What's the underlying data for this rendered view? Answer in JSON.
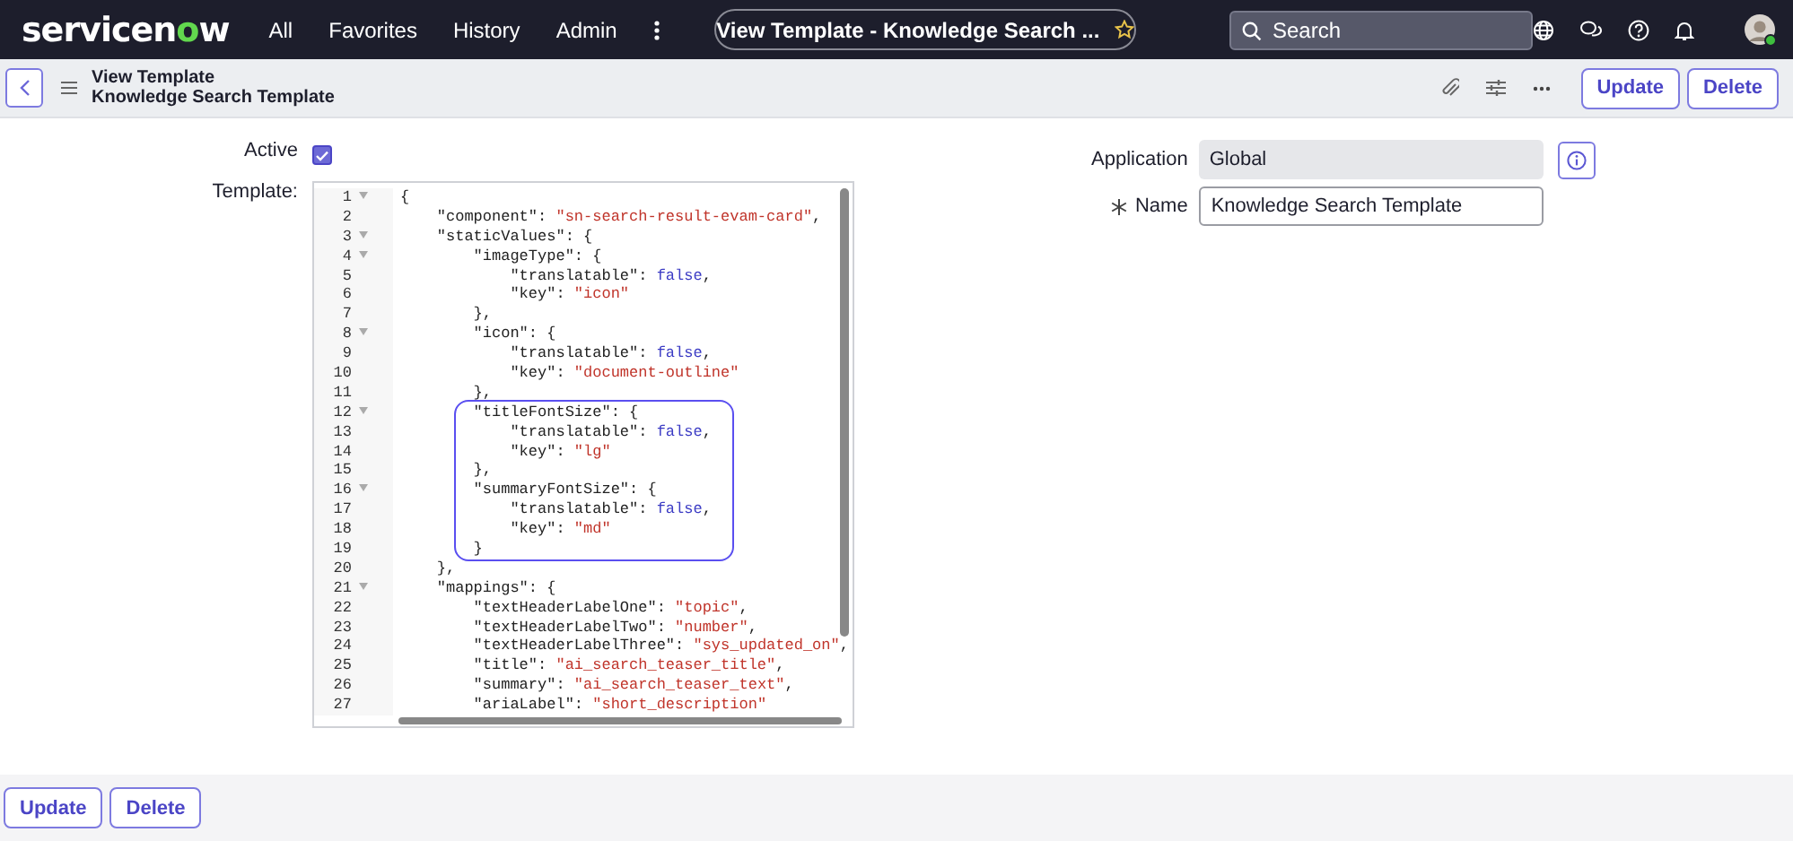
{
  "topbar": {
    "logo": [
      "servicen",
      "o",
      "w"
    ],
    "menu": [
      {
        "label": "All"
      },
      {
        "label": "Favorites"
      },
      {
        "label": "History"
      },
      {
        "label": "Admin"
      }
    ],
    "title_pill": {
      "text": "View Template - Knowledge Search ...",
      "starred": false
    },
    "search": {
      "placeholder": "Search"
    },
    "user": {
      "online": true
    }
  },
  "header": {
    "title": "View Template",
    "subtitle": "Knowledge Search Template",
    "buttons": [
      "Update",
      "Delete"
    ]
  },
  "form": {
    "active": {
      "label": "Active",
      "checked": true
    },
    "template": {
      "label": "Template:",
      "blocks": [
        {
          "highlighted": false,
          "lines": [
            {
              "n": "1",
              "fold": true,
              "tokens": [
                {
                  "kind": "plain",
                  "text": "{"
                }
              ]
            },
            {
              "n": "2",
              "fold": false,
              "tokens": [
                {
                  "kind": "plain",
                  "text": "    \"component\": "
                },
                {
                  "kind": "string",
                  "text": "\"sn-search-result-evam-card\""
                },
                {
                  "kind": "plain",
                  "text": ","
                }
              ]
            },
            {
              "n": "3",
              "fold": true,
              "tokens": [
                {
                  "kind": "plain",
                  "text": "    \"staticValues\": {"
                }
              ]
            },
            {
              "n": "4",
              "fold": true,
              "tokens": [
                {
                  "kind": "plain",
                  "text": "        \"imageType\": {"
                }
              ]
            },
            {
              "n": "5",
              "fold": false,
              "tokens": [
                {
                  "kind": "plain",
                  "text": "            \"translatable\": "
                },
                {
                  "kind": "literal",
                  "text": "false"
                },
                {
                  "kind": "plain",
                  "text": ","
                }
              ]
            },
            {
              "n": "6",
              "fold": false,
              "tokens": [
                {
                  "kind": "plain",
                  "text": "            \"key\": "
                },
                {
                  "kind": "string",
                  "text": "\"icon\""
                }
              ]
            },
            {
              "n": "7",
              "fold": false,
              "tokens": [
                {
                  "kind": "plain",
                  "text": "        },"
                }
              ]
            },
            {
              "n": "8",
              "fold": true,
              "tokens": [
                {
                  "kind": "plain",
                  "text": "        \"icon\": {"
                }
              ]
            },
            {
              "n": "9",
              "fold": false,
              "tokens": [
                {
                  "kind": "plain",
                  "text": "            \"translatable\": "
                },
                {
                  "kind": "literal",
                  "text": "false"
                },
                {
                  "kind": "plain",
                  "text": ","
                }
              ]
            },
            {
              "n": "10",
              "fold": false,
              "tokens": [
                {
                  "kind": "plain",
                  "text": "            \"key\": "
                },
                {
                  "kind": "string",
                  "text": "\"document-outline\""
                }
              ]
            },
            {
              "n": "11",
              "fold": false,
              "tokens": [
                {
                  "kind": "plain",
                  "text": "        },"
                }
              ]
            }
          ]
        },
        {
          "highlighted": true,
          "lines": [
            {
              "n": "12",
              "fold": true,
              "tokens": [
                {
                  "kind": "plain",
                  "text": "        \"titleFontSize\": {"
                }
              ]
            },
            {
              "n": "13",
              "fold": false,
              "tokens": [
                {
                  "kind": "plain",
                  "text": "            \"translatable\": "
                },
                {
                  "kind": "literal",
                  "text": "false"
                },
                {
                  "kind": "plain",
                  "text": ","
                }
              ]
            },
            {
              "n": "14",
              "fold": false,
              "tokens": [
                {
                  "kind": "plain",
                  "text": "            \"key\": "
                },
                {
                  "kind": "string",
                  "text": "\"lg\""
                }
              ]
            },
            {
              "n": "15",
              "fold": false,
              "tokens": [
                {
                  "kind": "plain",
                  "text": "        },"
                }
              ]
            },
            {
              "n": "16",
              "fold": true,
              "tokens": [
                {
                  "kind": "plain",
                  "text": "        \"summaryFontSize\": {"
                }
              ]
            },
            {
              "n": "17",
              "fold": false,
              "tokens": [
                {
                  "kind": "plain",
                  "text": "            \"translatable\": "
                },
                {
                  "kind": "literal",
                  "text": "false"
                },
                {
                  "kind": "plain",
                  "text": ","
                }
              ]
            },
            {
              "n": "18",
              "fold": false,
              "tokens": [
                {
                  "kind": "plain",
                  "text": "            \"key\": "
                },
                {
                  "kind": "string",
                  "text": "\"md\""
                }
              ]
            },
            {
              "n": "19",
              "fold": false,
              "tokens": [
                {
                  "kind": "plain",
                  "text": "        }"
                }
              ]
            }
          ]
        },
        {
          "highlighted": false,
          "lines": [
            {
              "n": "20",
              "fold": false,
              "tokens": [
                {
                  "kind": "plain",
                  "text": "    },"
                }
              ]
            },
            {
              "n": "21",
              "fold": true,
              "tokens": [
                {
                  "kind": "plain",
                  "text": "    \"mappings\": {"
                }
              ]
            },
            {
              "n": "22",
              "fold": false,
              "tokens": [
                {
                  "kind": "plain",
                  "text": "        \"textHeaderLabelOne\": "
                },
                {
                  "kind": "string",
                  "text": "\"topic\""
                },
                {
                  "kind": "plain",
                  "text": ","
                }
              ]
            },
            {
              "n": "23",
              "fold": false,
              "tokens": [
                {
                  "kind": "plain",
                  "text": "        \"textHeaderLabelTwo\": "
                },
                {
                  "kind": "string",
                  "text": "\"number\""
                },
                {
                  "kind": "plain",
                  "text": ","
                }
              ]
            },
            {
              "n": "24",
              "fold": false,
              "tokens": [
                {
                  "kind": "plain",
                  "text": "        \"textHeaderLabelThree\": "
                },
                {
                  "kind": "string",
                  "text": "\"sys_updated_on\""
                },
                {
                  "kind": "plain",
                  "text": ","
                }
              ]
            },
            {
              "n": "25",
              "fold": false,
              "tokens": [
                {
                  "kind": "plain",
                  "text": "        \"title\": "
                },
                {
                  "kind": "string",
                  "text": "\"ai_search_teaser_title\""
                },
                {
                  "kind": "plain",
                  "text": ","
                }
              ]
            },
            {
              "n": "26",
              "fold": false,
              "tokens": [
                {
                  "kind": "plain",
                  "text": "        \"summary\": "
                },
                {
                  "kind": "string",
                  "text": "\"ai_search_teaser_text\""
                },
                {
                  "kind": "plain",
                  "text": ","
                }
              ]
            },
            {
              "n": "27",
              "fold": false,
              "tokens": [
                {
                  "kind": "plain",
                  "text": "        \"ariaLabel\": "
                },
                {
                  "kind": "string",
                  "text": "\"short_description\""
                }
              ]
            }
          ]
        }
      ]
    },
    "application": {
      "label": "Application",
      "value": "Global"
    },
    "name": {
      "label": "Name",
      "required": true,
      "value": "Knowledge Search Template"
    }
  },
  "footer_buttons": [
    "Update",
    "Delete"
  ]
}
